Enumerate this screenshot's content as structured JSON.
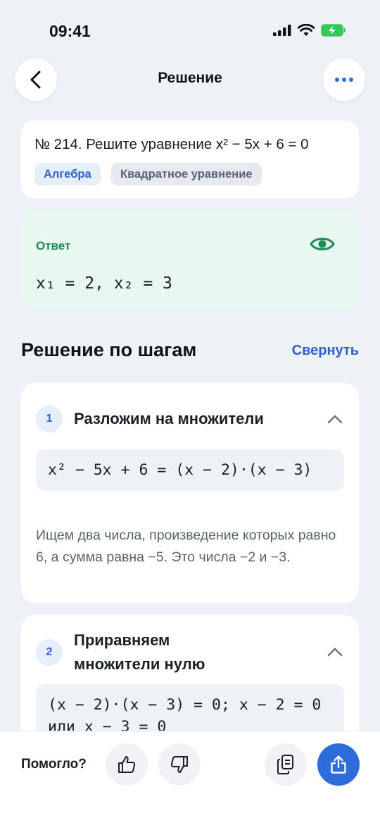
{
  "status": {
    "time": "09:41"
  },
  "header": {
    "title": "Решение"
  },
  "problem": {
    "text": "№ 214. Решите уравнение x² − 5x + 6 = 0",
    "tags": [
      "Алгебра",
      "Квадратное уравнение"
    ]
  },
  "answer": {
    "label": "Ответ",
    "value": "x₁ = 2, x₂ = 3"
  },
  "steps_section": {
    "title": "Решение по шагам",
    "collapse_label": "Свернуть"
  },
  "steps": [
    {
      "number": "1",
      "title": "Разложим на множители",
      "formula": "x² − 5x + 6 = (x − 2)·(x − 3)",
      "description": "Ищем два числа, произведение которых равно 6, а сумма равна −5. Это числа −2 и −3."
    },
    {
      "number": "2",
      "title": "Приравняем множители нулю",
      "formula": "(x − 2)·(x − 3) = 0; x − 2 = 0 или x − 3 = 0"
    }
  ],
  "bottom_bar": {
    "helped_label": "Помогло?"
  },
  "colors": {
    "accent": "#2E6BDB",
    "answer_bg": "#E8F7EF",
    "answer_text": "#1E8A55",
    "background": "#EEF2F7"
  }
}
